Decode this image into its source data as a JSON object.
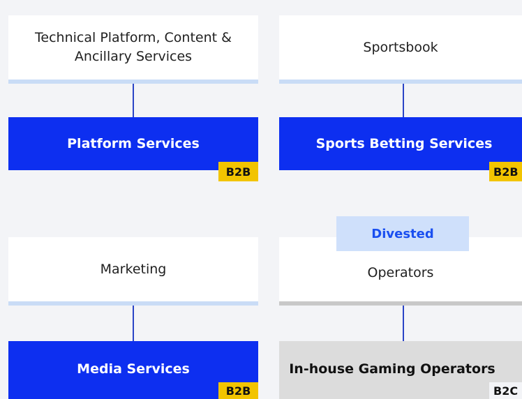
{
  "colors": {
    "primary_blue": "#0d2ff0",
    "bar_light_blue": "#c9dcf6",
    "connector_blue": "#2a44c6",
    "badge_yellow": "#f2c400",
    "gray_box": "#dcdcdc",
    "gray_bar": "#c8c8c8",
    "divested_bg": "#cfe0fb",
    "divested_text": "#1a4ff0"
  },
  "cards": [
    {
      "top_label": "Technical Platform, Content & Ancillary Services",
      "main_label": "Platform Services",
      "badge": "B2B",
      "style": "active"
    },
    {
      "top_label": "Sportsbook",
      "main_label": "Sports Betting Services",
      "badge": "B2B",
      "style": "active"
    },
    {
      "top_label": "Marketing",
      "main_label": "Media Services",
      "badge": "B2B",
      "style": "active"
    },
    {
      "top_label": "Operators",
      "main_label": "In-house Gaming Operators",
      "badge": "B2C",
      "style": "divested",
      "status_label": "Divested"
    }
  ]
}
